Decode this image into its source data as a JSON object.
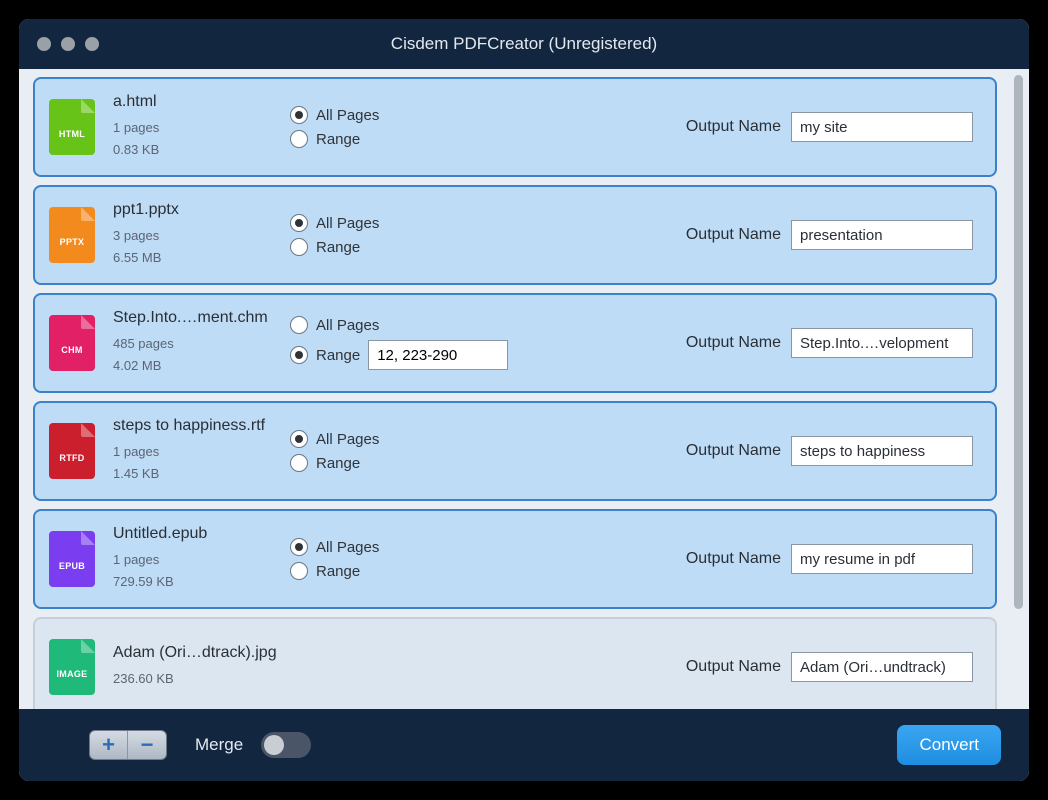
{
  "window": {
    "title": "Cisdem PDFCreator (Unregistered)"
  },
  "labels": {
    "all_pages": "All Pages",
    "range": "Range",
    "output_name": "Output Name",
    "merge": "Merge",
    "convert": "Convert",
    "pages_suffix": "pages"
  },
  "icons": {
    "add": "+",
    "remove": "−"
  },
  "files": [
    {
      "name": "a.html",
      "pages": "1 pages",
      "size": "0.83 KB",
      "type": "HTML",
      "color": "#67c317",
      "selection": "all",
      "range_value": "",
      "output": "my site",
      "active": true,
      "show_page_select": true
    },
    {
      "name": "ppt1.pptx",
      "pages": "3 pages",
      "size": "6.55 MB",
      "type": "PPTX",
      "color": "#f28a1d",
      "selection": "all",
      "range_value": "",
      "output": "presentation",
      "active": true,
      "show_page_select": true
    },
    {
      "name": "Step.Into.…ment.chm",
      "pages": "485 pages",
      "size": "4.02 MB",
      "type": "CHM",
      "color": "#e22065",
      "selection": "range",
      "range_value": "12, 223-290",
      "output": "Step.Into.…velopment",
      "active": true,
      "show_page_select": true
    },
    {
      "name": "steps to happiness.rtf",
      "pages": "1 pages",
      "size": "1.45 KB",
      "type": "RTFD",
      "color": "#cc1f2e",
      "selection": "all",
      "range_value": "",
      "output": "steps to happiness",
      "active": true,
      "show_page_select": true
    },
    {
      "name": "Untitled.epub",
      "pages": "1 pages",
      "size": "729.59 KB",
      "type": "EPUB",
      "color": "#7a3df0",
      "selection": "all",
      "range_value": "",
      "output": "my resume in pdf",
      "active": true,
      "show_page_select": true
    },
    {
      "name": "Adam (Ori…dtrack).jpg",
      "pages": "",
      "size": "236.60 KB",
      "type": "IMAGE",
      "color": "#1fb97a",
      "selection": "none",
      "range_value": "",
      "output": "Adam (Ori…undtrack)",
      "active": false,
      "show_page_select": false
    }
  ]
}
